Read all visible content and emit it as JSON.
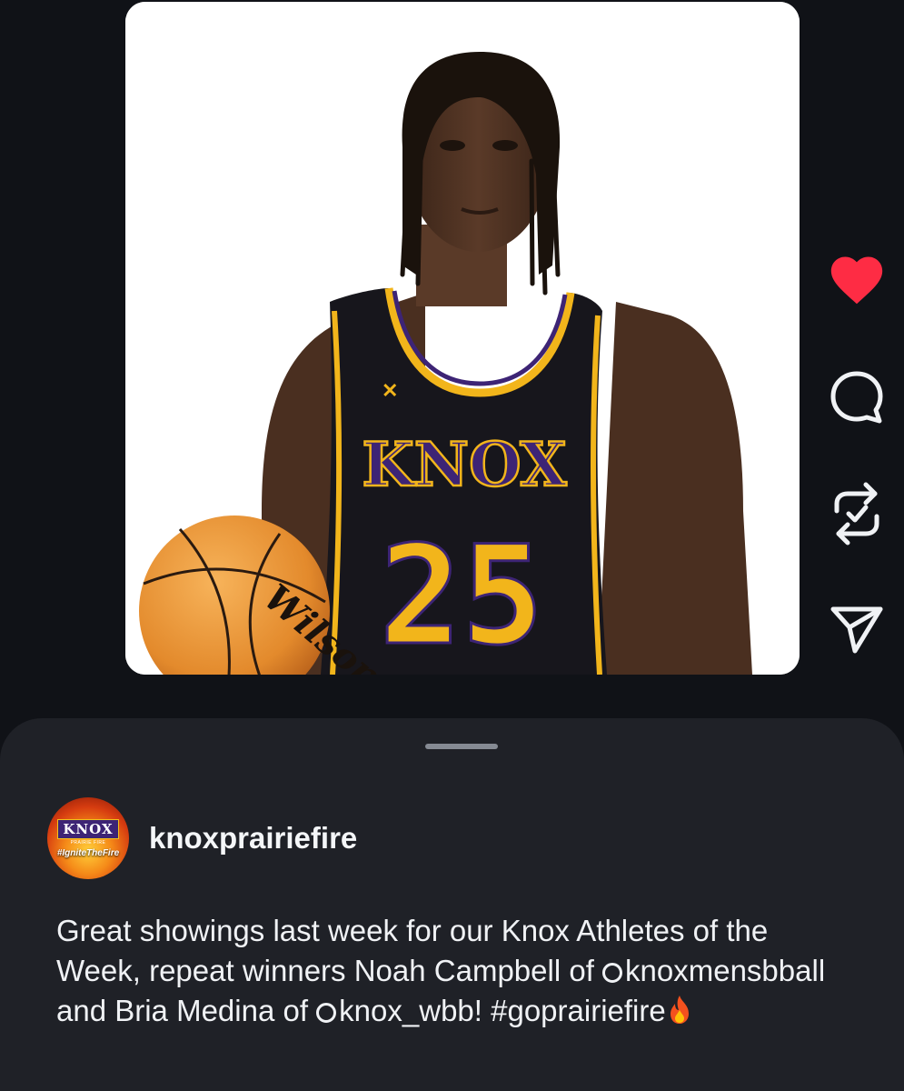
{
  "post": {
    "username": "knoxprairiefire",
    "caption": {
      "text1": "Great showings last week for our Knox Athletes of the Week, repeat winners Noah Campbell of ",
      "mention1": "knoxmensbball",
      "text2": " and Bria Medina of ",
      "mention2": "knox_wbb",
      "text3": "! ",
      "hashtag": "#goprairiefire"
    },
    "liked": true
  },
  "avatar": {
    "name": "KNOX",
    "sub": "PRAIRIE FIRE",
    "tag": "#IgniteTheFire"
  },
  "image": {
    "jersey_text": "KNOX",
    "jersey_number": "25",
    "ball_text": "Wilson"
  },
  "icons": {
    "like": "heart-icon",
    "reply": "comment-icon",
    "repost": "repost-icon",
    "share": "send-icon",
    "emoji": "fire-emoji"
  },
  "colors": {
    "like": "#fe2c44",
    "background": "#101217",
    "sheet": "#1f2127",
    "jersey": "#17161c",
    "jersey_trim": "#f2b51b",
    "jersey_accent": "#3d2475"
  }
}
